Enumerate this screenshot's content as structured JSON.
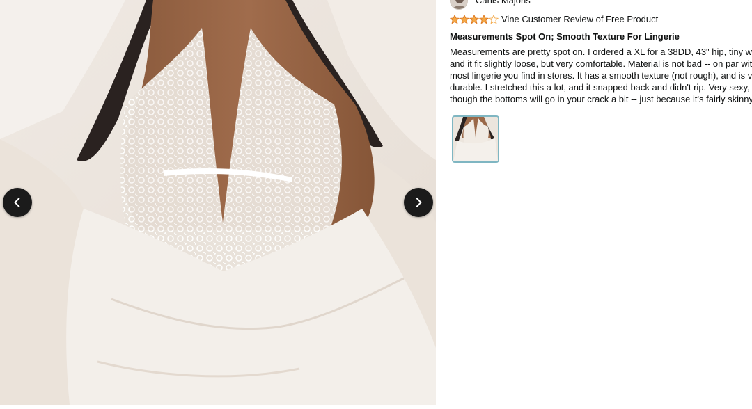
{
  "reviewer": {
    "name": "Canis Majoris",
    "avatar_icon": "user-avatar-icon"
  },
  "rating": {
    "stars_filled": 4,
    "stars_total": 5,
    "star_color": "#f3a847",
    "label": "Vine Customer Review of Free Product"
  },
  "review": {
    "title": "Measurements Spot On; Smooth Texture For Lingerie",
    "body_lines": [
      "Measurements are pretty spot on. I ordered a XL for a 38DD, 43\" hip, tiny waist --",
      "and it fit slightly loose, but very comfortable. Material is not bad -- on par with",
      "most lingerie you find in stores. It has a smooth texture (not rough), and is very",
      "durable. I stretched this a lot, and it snapped back and didn't rip. Very sexy,",
      "though the bottoms will go in your crack a bit -- just because it's fairly skinny!"
    ]
  },
  "gallery": {
    "prev_icon": "chevron-left-icon",
    "next_icon": "chevron-right-icon",
    "thumbnail_count": 1,
    "thumb_border_color": "#7fb6c2"
  }
}
